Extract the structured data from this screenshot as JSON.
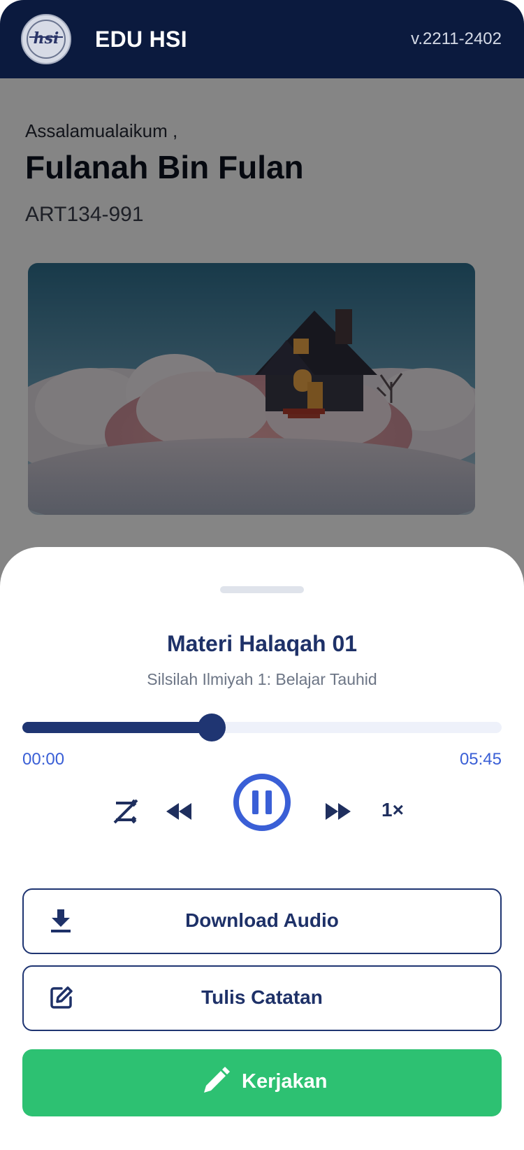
{
  "header": {
    "logo_text": "hsi",
    "app_title": "EDU HSI",
    "version": "v.2211-2402"
  },
  "profile": {
    "greeting": "Assalamualaikum ,",
    "name": "Fulanah  Bin Fulan",
    "code": "ART134-991"
  },
  "hero": {
    "image_icon": "house-on-clouds-image"
  },
  "player": {
    "title": "Materi Halaqah 01",
    "subtitle": "Silsilah Ilmiyah 1: Belajar Tauhid",
    "progress_fraction": 0.395,
    "time_current": "00:00",
    "time_total": "05:45",
    "controls": {
      "shuffle_icon": "shuffle-off-icon",
      "rewind_icon": "rewind-icon",
      "play_pause_icon": "pause-icon",
      "forward_icon": "fast-forward-icon",
      "speed_label": "1×"
    }
  },
  "actions": {
    "download_label": "Download Audio",
    "download_icon": "download-icon",
    "notes_label": "Tulis Catatan",
    "notes_icon": "edit-note-icon",
    "work_label": "Kerjakan",
    "work_icon": "pencil-icon"
  },
  "colors": {
    "header_bg": "#0b1a3e",
    "primary": "#1f3572",
    "accent_blue": "#3a5fd6",
    "green": "#2dc172",
    "track_bg": "#eef1fa"
  }
}
